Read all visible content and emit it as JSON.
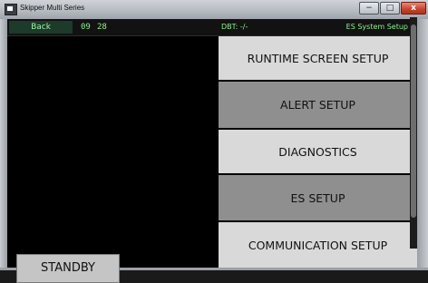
{
  "window": {
    "title": "Skipper Multi Series",
    "minimize_glyph": "−",
    "maximize_glyph": "□",
    "close_glyph": "x"
  },
  "header": {
    "back_label": "Back",
    "value_a": "09",
    "value_b": "28",
    "dbt_label": "DBT: -/-",
    "section_title": "ES System Setup"
  },
  "left_panel": {
    "standby_label": "STANDBY"
  },
  "menu": {
    "items": [
      {
        "label": "RUNTIME SCREEN SETUP",
        "tone": "light"
      },
      {
        "label": "ALERT SETUP",
        "tone": "dark"
      },
      {
        "label": "DIAGNOSTICS",
        "tone": "light"
      },
      {
        "label": "ES SETUP",
        "tone": "dark"
      },
      {
        "label": "COMMUNICATION SETUP",
        "tone": "light"
      }
    ]
  },
  "colors": {
    "header_text": "#8ff08f",
    "menu_light": "#d9d9d9",
    "menu_dark": "#8f8f8f",
    "background": "#000000"
  }
}
